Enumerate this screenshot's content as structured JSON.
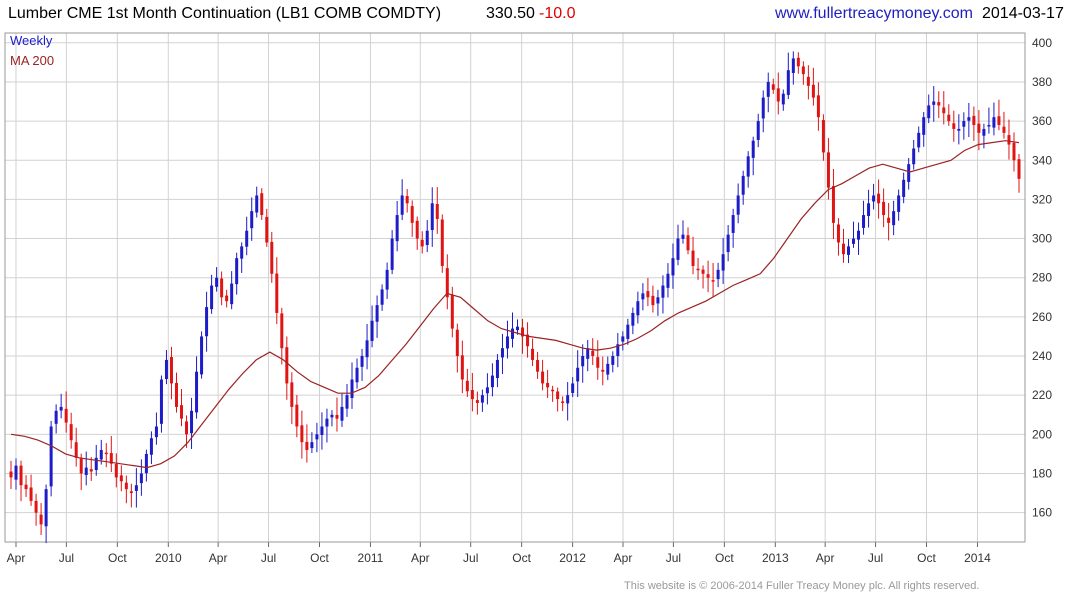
{
  "header": {
    "title": "Lumber CME 1st Month Continuation (LB1 COMB COMDTY)",
    "last": "330.50",
    "change": "-10.0",
    "website": "www.fullertreacymoney.com",
    "date": "2014-03-17"
  },
  "footer": {
    "copyright": "This website is © 2006-2014 Fuller Treacy Money plc. All rights reserved."
  },
  "colors": {
    "up": "#1c1cc8",
    "down": "#e11414",
    "ma": "#9b2323",
    "grid": "#d2d2d2",
    "frame": "#9a9a9a"
  },
  "chart_data": {
    "type": "candlestick",
    "legend": {
      "labels": [
        "Weekly",
        "MA 200"
      ],
      "placement": "top-left"
    },
    "y_ticks": [
      160,
      180,
      200,
      220,
      240,
      260,
      280,
      300,
      320,
      340,
      360,
      380,
      400
    ],
    "ylim": [
      145,
      405
    ],
    "x_tick_labels": [
      "Apr",
      "Jul",
      "Oct",
      "2010",
      "Apr",
      "Jul",
      "Oct",
      "2011",
      "Apr",
      "Jul",
      "Oct",
      "2012",
      "Apr",
      "Jul",
      "Oct",
      "2013",
      "Apr",
      "Jul",
      "Oct",
      "2014"
    ],
    "x_start": "2009-03-23",
    "x_end": "2014-03-17",
    "grid": true,
    "weekly_close": [
      178,
      184,
      174,
      172,
      166,
      160,
      154,
      172,
      204,
      212,
      214,
      206,
      197,
      188,
      180,
      183,
      181,
      188,
      192,
      190,
      185,
      178,
      176,
      172,
      170,
      174,
      180,
      190,
      198,
      204,
      228,
      238,
      226,
      214,
      208,
      200,
      212,
      232,
      250,
      265,
      276,
      280,
      270,
      268,
      277,
      290,
      296,
      304,
      314,
      322,
      312,
      298,
      282,
      262,
      244,
      226,
      214,
      204,
      196,
      192,
      196,
      200,
      204,
      208,
      210,
      208,
      214,
      220,
      228,
      234,
      240,
      248,
      258,
      266,
      274,
      284,
      300,
      312,
      322,
      318,
      308,
      300,
      296,
      304,
      318,
      310,
      286,
      270,
      254,
      240,
      228,
      222,
      218,
      216,
      220,
      224,
      230,
      238,
      244,
      250,
      254,
      255,
      250,
      245,
      238,
      232,
      226,
      224,
      222,
      218,
      216,
      220,
      226,
      234,
      240,
      244,
      240,
      234,
      232,
      236,
      240,
      246,
      250,
      256,
      262,
      268,
      272,
      270,
      266,
      270,
      276,
      282,
      290,
      300,
      302,
      294,
      286,
      284,
      282,
      280,
      278,
      284,
      292,
      302,
      312,
      322,
      332,
      342,
      350,
      360,
      372,
      380,
      376,
      370,
      374,
      386,
      392,
      388,
      384,
      378,
      372,
      362,
      344,
      326,
      308,
      298,
      292,
      296,
      300,
      304,
      312,
      318,
      322,
      318,
      312,
      308,
      314,
      322,
      330,
      338,
      346,
      354,
      362,
      368,
      370,
      368,
      364,
      360,
      356,
      356,
      360,
      362,
      358,
      354,
      356,
      358,
      362,
      358,
      354,
      348,
      340,
      330.5
    ],
    "ma200_approx": [
      200,
      199,
      197,
      194,
      190,
      188,
      187,
      186,
      185,
      184,
      183,
      185,
      189,
      196,
      205,
      214,
      223,
      231,
      238,
      242,
      238,
      232,
      227,
      224,
      221,
      221,
      224,
      230,
      238,
      246,
      255,
      264,
      272,
      270,
      264,
      258,
      254,
      252,
      250,
      249,
      248,
      246,
      244,
      243,
      244,
      246,
      249,
      253,
      258,
      262,
      265,
      268,
      272,
      276,
      279,
      282,
      290,
      300,
      310,
      318,
      325,
      328,
      332,
      336,
      338,
      336,
      334,
      336,
      338,
      340,
      345,
      348,
      349,
      350,
      349
    ]
  }
}
